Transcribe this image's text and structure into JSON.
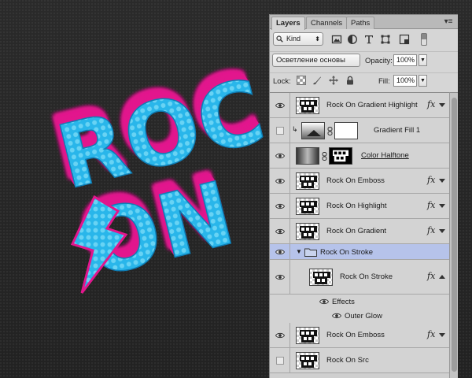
{
  "artwork": {
    "line1": "ROC",
    "line2": "ON",
    "fill_color": "#2ec3ee",
    "extrude_color": "#e2168d",
    "background_color": "#262626"
  },
  "panel": {
    "tabs": [
      {
        "label": "Layers",
        "active": true
      },
      {
        "label": "Channels",
        "active": false
      },
      {
        "label": "Paths",
        "active": false
      }
    ],
    "menu_icon": "panel-menu-icon",
    "filter": {
      "kind_label": "Kind",
      "icons": [
        "pixel-filter-icon",
        "adjustment-filter-icon",
        "type-filter-icon",
        "shape-filter-icon",
        "smart-object-filter-icon"
      ]
    },
    "blend_mode": "Осветление основы",
    "opacity_label": "Opacity:",
    "opacity_value": "100%",
    "lock_label": "Lock:",
    "lock_icons": [
      "lock-transparent-icon",
      "lock-paint-icon",
      "lock-move-icon",
      "lock-all-icon"
    ],
    "fill_label": "Fill:",
    "fill_value": "100%"
  },
  "layers": [
    {
      "name": "Rock On Gradient Highlight",
      "visible": true,
      "thumb": "logo",
      "fx": "fx",
      "selected": false
    },
    {
      "name": "Gradient Fill 1",
      "visible": false,
      "thumb": "gradient",
      "fx": "",
      "clipped": true,
      "selected": false
    },
    {
      "name": "Color Halftone",
      "visible": true,
      "thumb": "halftone",
      "fx": "",
      "selected": false,
      "underline": true
    },
    {
      "name": "Rock On Emboss",
      "visible": true,
      "thumb": "logo",
      "fx": "fx",
      "selected": false
    },
    {
      "name": "Rock On Highlight",
      "visible": true,
      "thumb": "logo",
      "fx": "fx",
      "selected": false
    },
    {
      "name": "Rock On Gradient",
      "visible": true,
      "thumb": "logo",
      "fx": "fx",
      "selected": false
    },
    {
      "name": "Rock On Stroke",
      "visible": true,
      "thumb": "folder",
      "fx": "",
      "selected": true,
      "group": true
    },
    {
      "name": "Rock On Stroke",
      "visible": true,
      "thumb": "logo",
      "fx": "fx",
      "selected": false,
      "indent": true
    },
    {
      "name": "Effects",
      "visible": true,
      "thumb": "none",
      "fx": "",
      "effect_row": true
    },
    {
      "name": "Outer Glow",
      "visible": true,
      "thumb": "none",
      "fx": "",
      "effect_row": true,
      "sub": true
    },
    {
      "name": "Rock On Emboss",
      "visible": true,
      "thumb": "logo",
      "fx": "fx",
      "selected": false
    },
    {
      "name": "Rock On Src",
      "visible": false,
      "thumb": "logo",
      "fx": "",
      "selected": false
    }
  ]
}
